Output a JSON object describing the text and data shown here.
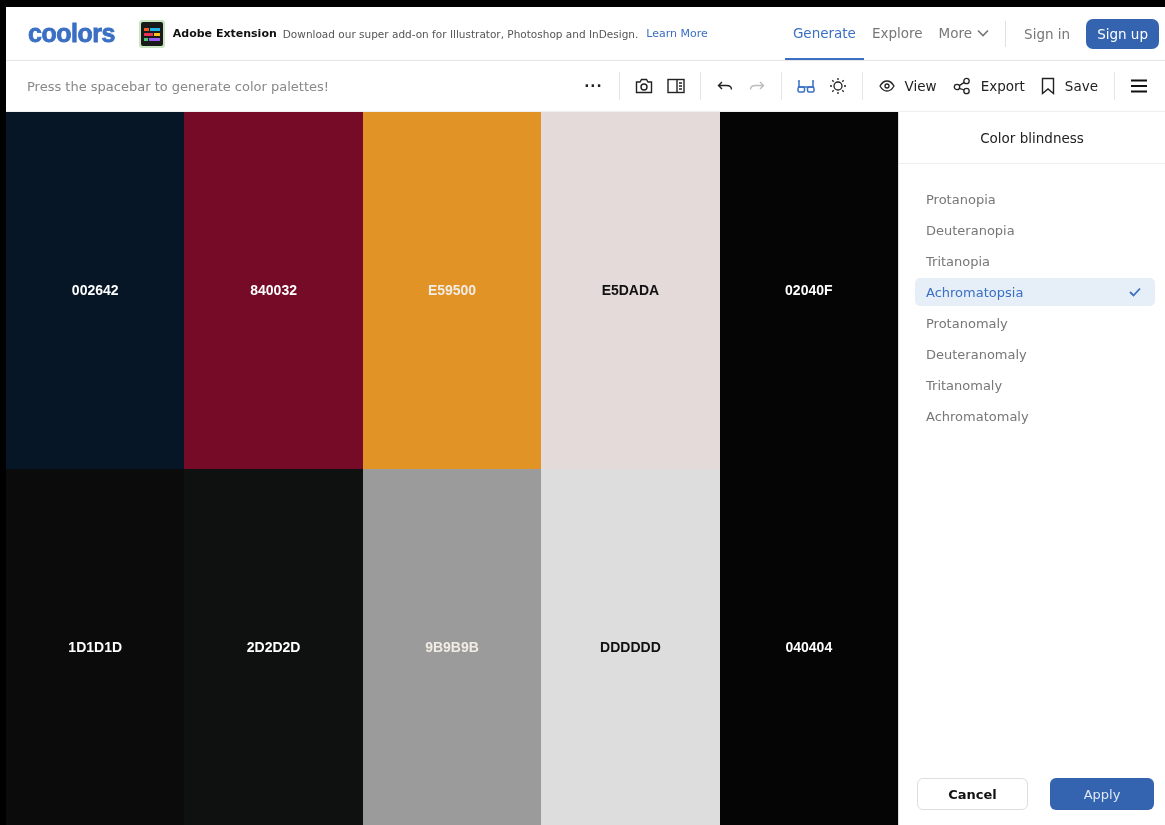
{
  "header": {
    "logo": "coolors",
    "promo": {
      "title": "Adobe Extension",
      "text": "Download our super add-on for Illustrator, Photoshop and InDesign.",
      "link": "Learn More"
    },
    "nav": [
      {
        "label": "Generate",
        "selected": true,
        "kind": "tab"
      },
      {
        "label": "Explore",
        "selected": false,
        "kind": "tab"
      },
      {
        "label": "More",
        "selected": false,
        "kind": "menu"
      }
    ],
    "sign_in": "Sign in",
    "sign_up": "Sign up"
  },
  "toolbar": {
    "hint": "Press the spacebar to generate color palettes!",
    "more": "···",
    "view": "View",
    "export": "Export",
    "save": "Save"
  },
  "original_swatches": [
    {
      "label": "002642",
      "color": "#061626"
    },
    {
      "label": "840032",
      "color": "#750b27"
    },
    {
      "label": "E59500",
      "color": "#e29325"
    },
    {
      "label": "E5DADA",
      "color": "#e5dada"
    },
    {
      "label": "02040F",
      "color": "#050506"
    }
  ],
  "simulated_swatches": [
    {
      "label": "1D1D1D",
      "color": "#0b0b0b"
    },
    {
      "label": "2D2D2D",
      "color": "#0f1110"
    },
    {
      "label": "9B9B9B",
      "color": "#9b9b9b"
    },
    {
      "label": "DDDDDD",
      "color": "#dddddd"
    },
    {
      "label": "040404",
      "color": "#050505"
    }
  ],
  "panel": {
    "title": "Color blindness",
    "options": [
      {
        "label": "Protanopia",
        "selected": false
      },
      {
        "label": "Deuteranopia",
        "selected": false
      },
      {
        "label": "Tritanopia",
        "selected": false
      },
      {
        "label": "Achromatopsia",
        "selected": true
      },
      {
        "label": "Protanomaly",
        "selected": false
      },
      {
        "label": "Deuteranomaly",
        "selected": false
      },
      {
        "label": "Tritanomaly",
        "selected": false
      },
      {
        "label": "Achromatomaly",
        "selected": false
      }
    ],
    "cancel": "Cancel",
    "apply": "Apply"
  }
}
